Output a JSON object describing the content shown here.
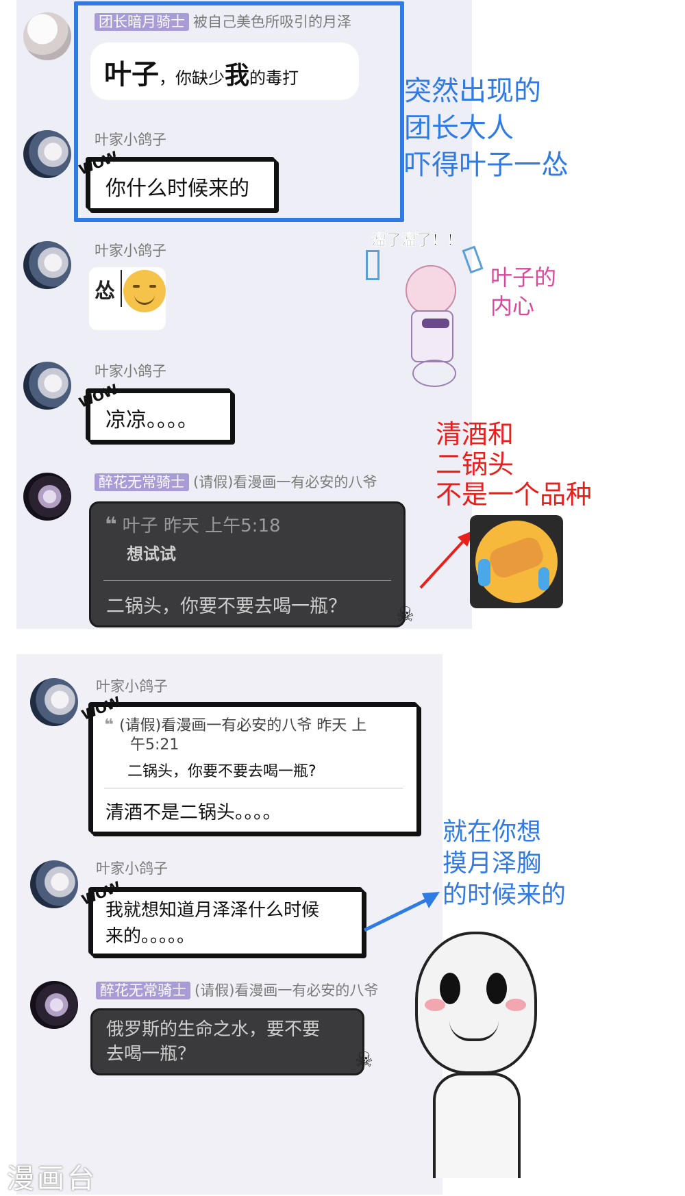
{
  "panel1": {
    "msg1": {
      "badge": "团长暗月骑士",
      "sender": "被自己美色所吸引的月泽",
      "text_a": "叶子",
      "text_b": "，你缺少",
      "text_c": "我",
      "text_d": "的毒打"
    },
    "msg2": {
      "sender": "叶家小鸽子",
      "wow": "WOW",
      "text": "你什么时候来的"
    },
    "msg3": {
      "sender": "叶家小鸽子",
      "sticker_text": "怂"
    },
    "msg4": {
      "sender": "叶家小鸽子",
      "wow": "WOW",
      "text": "凉凉。。。。"
    },
    "msg5": {
      "badge": "醉花无常骑士",
      "sender": "(请假)看漫画一有必安的八爷",
      "quote_header": "叶子 昨天 上午5:18",
      "quote_text": "想试试",
      "reply": "二锅头，你要不要去喝一瓶？",
      "skull_icon": "skull-icon"
    }
  },
  "annotations": {
    "blue_note": [
      "突然出现的",
      "团长大人",
      "吓得叶子一怂"
    ],
    "sticker_caption": "溜了溜了！！",
    "pink_note": [
      "叶子的",
      "内心"
    ],
    "red_note": [
      "清酒和",
      "二锅头",
      "不是一个品种"
    ],
    "blue_note2": [
      "就在你想",
      "摸月泽胸",
      "的时候来的"
    ]
  },
  "panel2": {
    "msg1": {
      "sender": "叶家小鸽子",
      "wow": "WOW",
      "quote_header": "(请假)看漫画一有必安的八爷 昨天 上",
      "quote_header2": "午5:21",
      "quote_text": "二锅头，你要不要去喝一瓶?",
      "reply": "清酒不是二锅头。。。。"
    },
    "msg2": {
      "sender": "叶家小鸽子",
      "wow": "WOW",
      "line1": "我就想知道月泽泽什么时候",
      "line2": "来的。。。。。"
    },
    "msg3": {
      "badge": "醉花无常骑士",
      "sender": "(请假)看漫画一有必安的八爷",
      "line1": "俄罗斯的生命之水，要不要",
      "line2": "去喝一瓶？",
      "skull_icon": "skull-icon"
    }
  },
  "watermark": "漫画台",
  "colors": {
    "blue": "#2f7be3",
    "pink": "#d9489a",
    "red": "#e8201c",
    "badge": "#a89bd6"
  }
}
